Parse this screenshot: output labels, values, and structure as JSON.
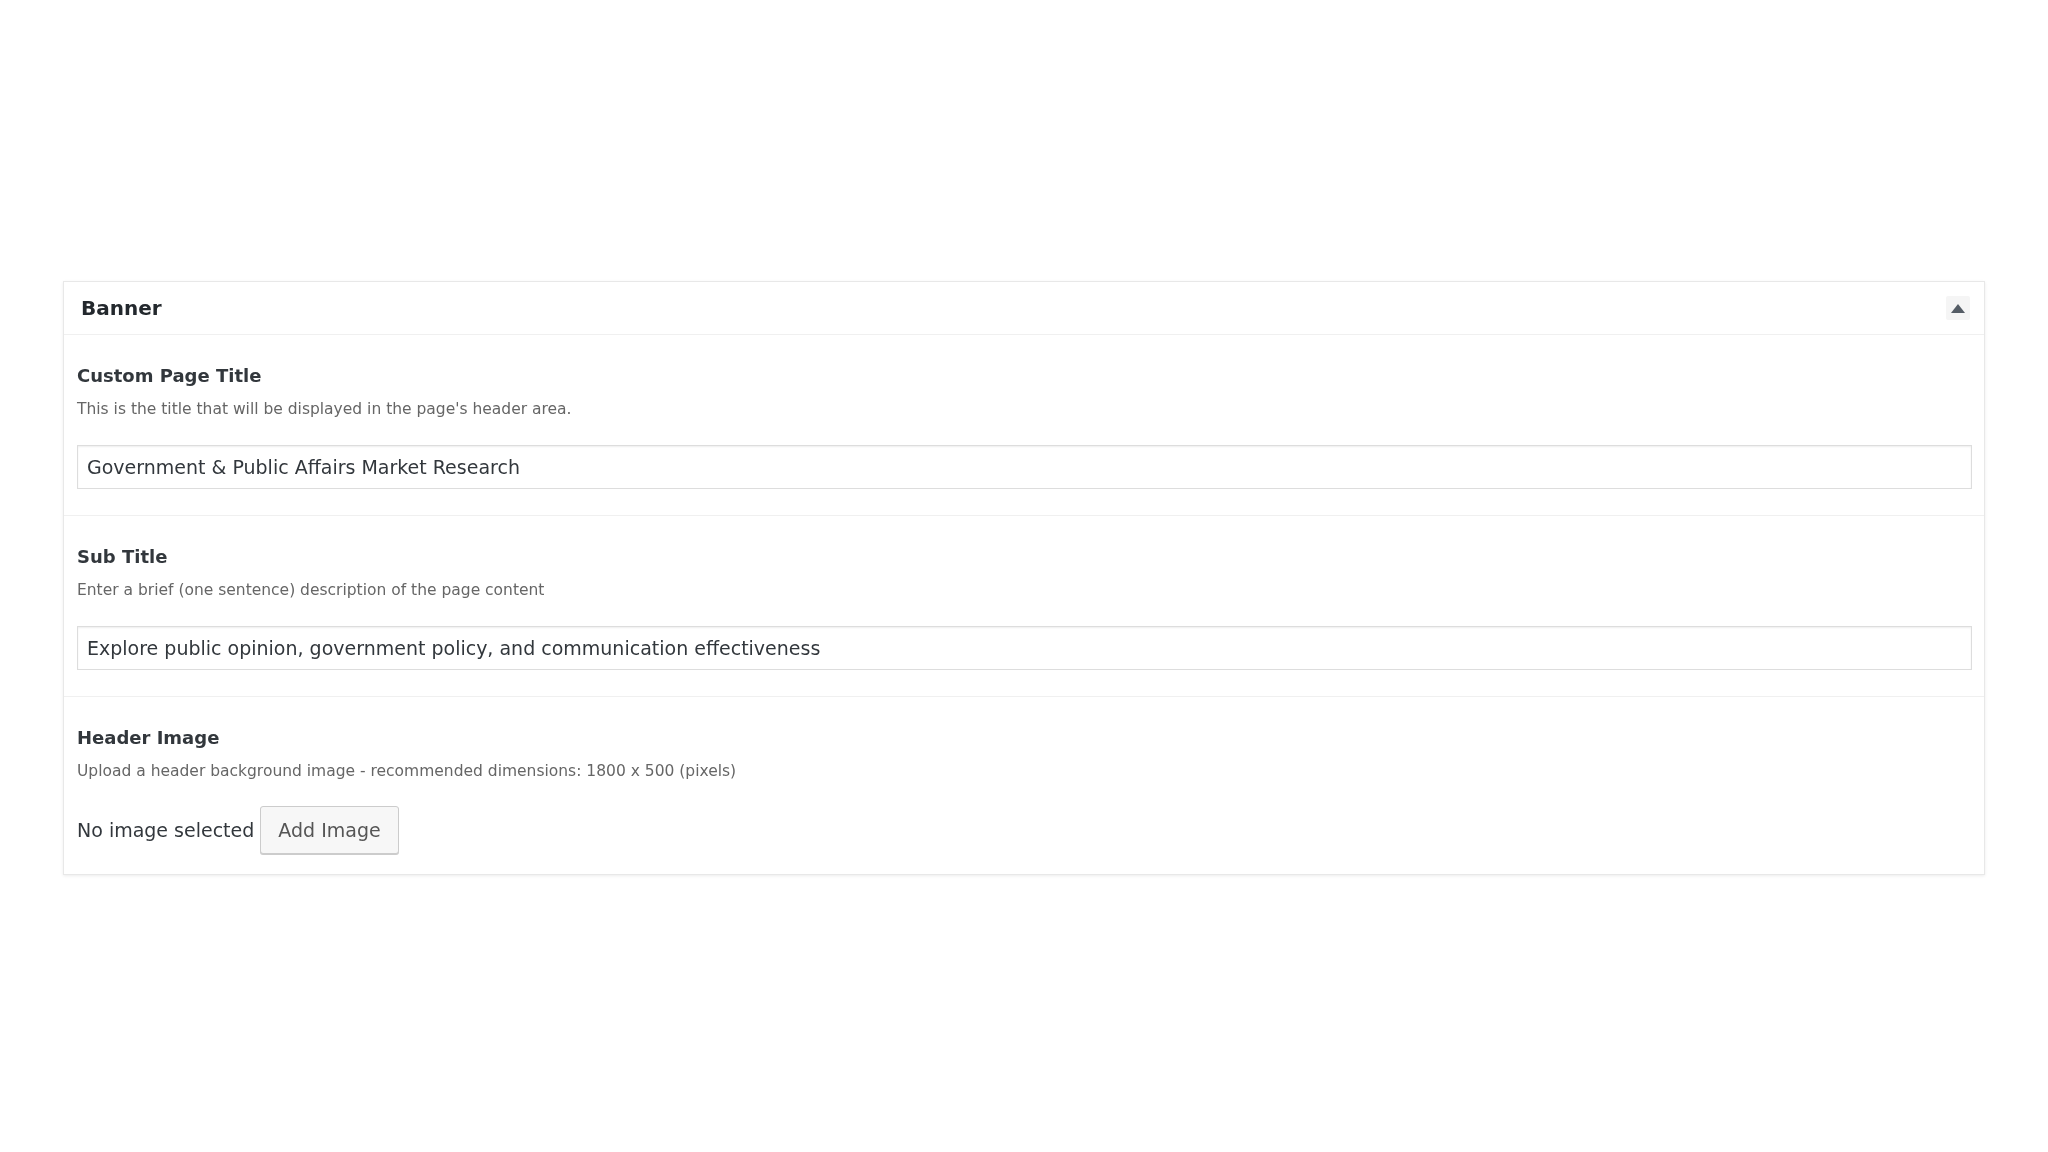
{
  "panel": {
    "title": "Banner",
    "expanded": true
  },
  "fields": [
    {
      "kind": "text",
      "label": "Custom Page Title",
      "description": "This is the title that will be displayed in the page's header area.",
      "value": "Government & Public Affairs Market Research"
    },
    {
      "kind": "text",
      "label": "Sub Title",
      "description": "Enter a brief (one sentence) description of the page content",
      "value": "Explore public opinion, government policy, and communication effectiveness"
    },
    {
      "kind": "image",
      "label": "Header Image",
      "description": "Upload a header background image - recommended dimensions: 1800 x 500 (pixels)",
      "status": "No image selected",
      "button": "Add Image"
    }
  ]
}
